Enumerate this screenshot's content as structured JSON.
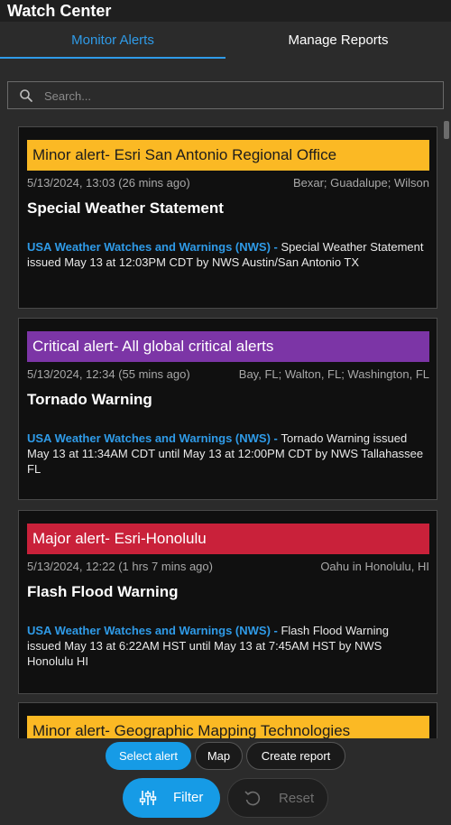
{
  "app": {
    "title": "Watch Center"
  },
  "tabs": [
    {
      "label": "Monitor Alerts",
      "active": true
    },
    {
      "label": "Manage Reports",
      "active": false
    }
  ],
  "search": {
    "placeholder": "Search...",
    "value": ""
  },
  "alerts": [
    {
      "banner": "Minor alert- Esri San Antonio Regional Office",
      "severity": "minor",
      "time": "5/13/2024, 13:03 (26 mins ago)",
      "location": "Bexar; Guadalupe; Wilson",
      "event": "Special Weather Statement",
      "source": "USA Weather Watches and Warnings (NWS)",
      "separator": " - ",
      "description": "Special Weather Statement issued May 13 at 12:03PM CDT by NWS Austin/San Antonio TX"
    },
    {
      "banner": "Critical alert- All global critical alerts",
      "severity": "critical",
      "time": "5/13/2024, 12:34 (55 mins ago)",
      "location": "Bay, FL; Walton, FL; Washington, FL",
      "event": "Tornado Warning",
      "source": "USA Weather Watches and Warnings (NWS)",
      "separator": " - ",
      "description": "Tornado Warning issued May 13 at 11:34AM CDT until May 13 at 12:00PM CDT by NWS Tallahassee FL"
    },
    {
      "banner": "Major alert- Esri-Honolulu",
      "severity": "major",
      "time": "5/13/2024, 12:22 (1 hrs 7 mins ago)",
      "location": "Oahu in Honolulu, HI",
      "event": "Flash Flood Warning",
      "source": "USA Weather Watches and Warnings (NWS)",
      "separator": " - ",
      "description": "Flash Flood Warning issued May 13 at 6:22AM HST until May 13 at 7:45AM HST by NWS Honolulu HI"
    },
    {
      "banner": "Minor alert- Geographic Mapping Technologies",
      "severity": "minor"
    }
  ],
  "toolbar": {
    "select_alert": "Select alert",
    "map": "Map",
    "create_report": "Create report",
    "filter": "Filter",
    "reset": "Reset"
  },
  "colors": {
    "accent": "#169be6",
    "minor": "#fbb924",
    "critical": "#7c35a6",
    "major": "#c9213a",
    "link": "#2f9be8"
  },
  "icons": {
    "search": "search-icon",
    "filter": "sliders-icon",
    "reset": "reset-icon"
  }
}
